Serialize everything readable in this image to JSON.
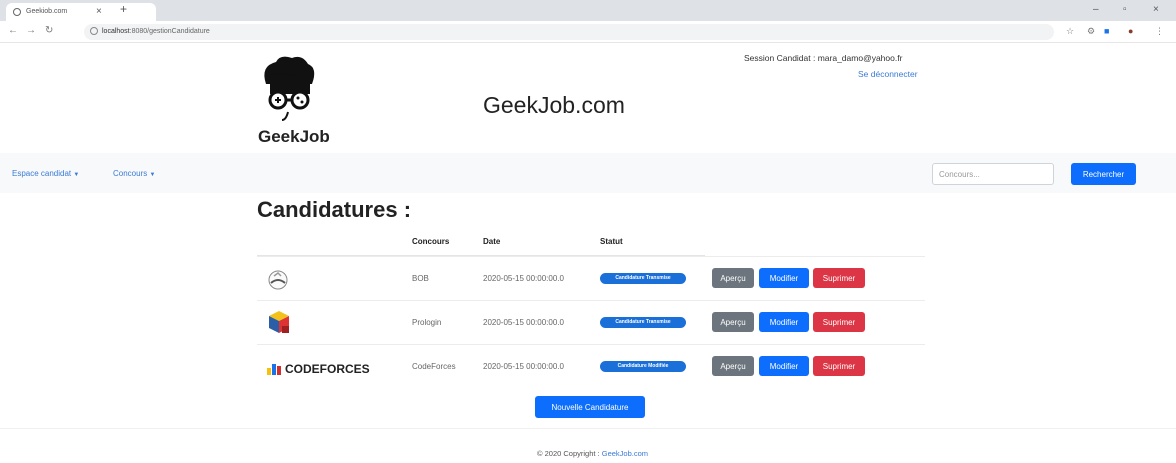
{
  "browser": {
    "tab_title": "Geekiob.com",
    "tab_close": "×",
    "new_tab": "+",
    "url_host": "localhost",
    "url_rest": ":8080/gestionCandidature",
    "minimize": "–",
    "maximize": "▫",
    "close": "×"
  },
  "header": {
    "logo_text": "GeekJob",
    "site_title": "GeekJob.com",
    "session_text": "Session Candidat : mara_damo@yahoo.fr",
    "logout_link": "Se déconnecter"
  },
  "navbar": {
    "items": [
      {
        "label": "Espace candidat"
      },
      {
        "label": "Concours"
      }
    ],
    "search_placeholder": "Concours...",
    "search_button": "Rechercher"
  },
  "main": {
    "heading": "Candidatures :",
    "columns": [
      "Concours",
      "Date",
      "Statut"
    ],
    "rows": [
      {
        "concours": "BOB",
        "date": "2020-05-15 00:00:00.0",
        "statut": "Candidature Transmise"
      },
      {
        "concours": "Prologin",
        "date": "2020-05-15 00:00:00.0",
        "statut": "Candidature Transmise"
      },
      {
        "concours": "CodeForces",
        "date": "2020-05-15 00:00:00.0",
        "statut": "Candidature Modifiée"
      }
    ],
    "actions": {
      "apercu": "Aperçu",
      "modifier": "Modifier",
      "supprimer": "Suprimer"
    },
    "codeforces_logo_text": "CODEFORCES",
    "new_button": "Nouvelle Candidature"
  },
  "footer": {
    "text": "© 2020 Copyright :",
    "link": "GeekJob.com"
  },
  "colors": {
    "primary": "#0d6efd",
    "secondary": "#6c757d",
    "danger": "#dc3545",
    "badge": "#1a6fd8",
    "link": "#3a7bd5"
  }
}
